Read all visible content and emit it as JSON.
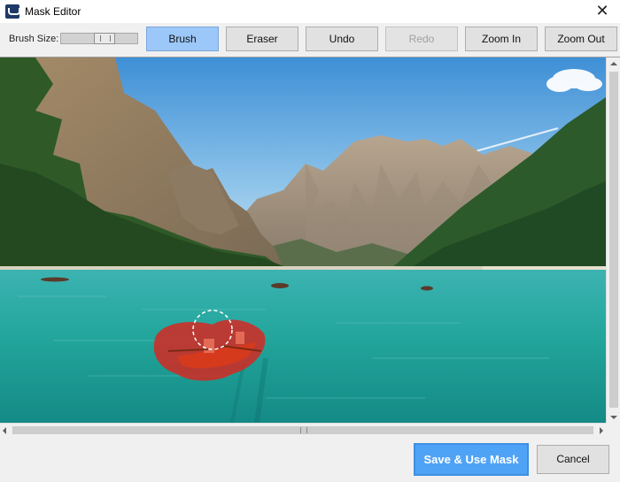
{
  "window": {
    "title": "Mask Editor",
    "app_icon": "mask-editor-app-icon",
    "close_glyph": "✕"
  },
  "toolbar": {
    "brush_size_label": "Brush Size:",
    "brush_size_level": 0.6,
    "buttons": {
      "brush": "Brush",
      "eraser": "Eraser",
      "undo": "Undo",
      "redo": "Redo",
      "zoom_in": "Zoom In",
      "zoom_out": "Zoom Out"
    },
    "active_tool": "Brush",
    "disabled": [
      "Redo"
    ]
  },
  "canvas": {
    "image_subject": "mountain-lake-with-rowboat",
    "mask_color": "#e0201a",
    "brush_cursor": "dashed-circle"
  },
  "actions": {
    "save": "Save & Use Mask",
    "cancel": "Cancel"
  },
  "colors": {
    "accent": "#4fa3f7",
    "active_tool_bg": "#9cc8f9",
    "window_bg": "#f0f0f0"
  }
}
